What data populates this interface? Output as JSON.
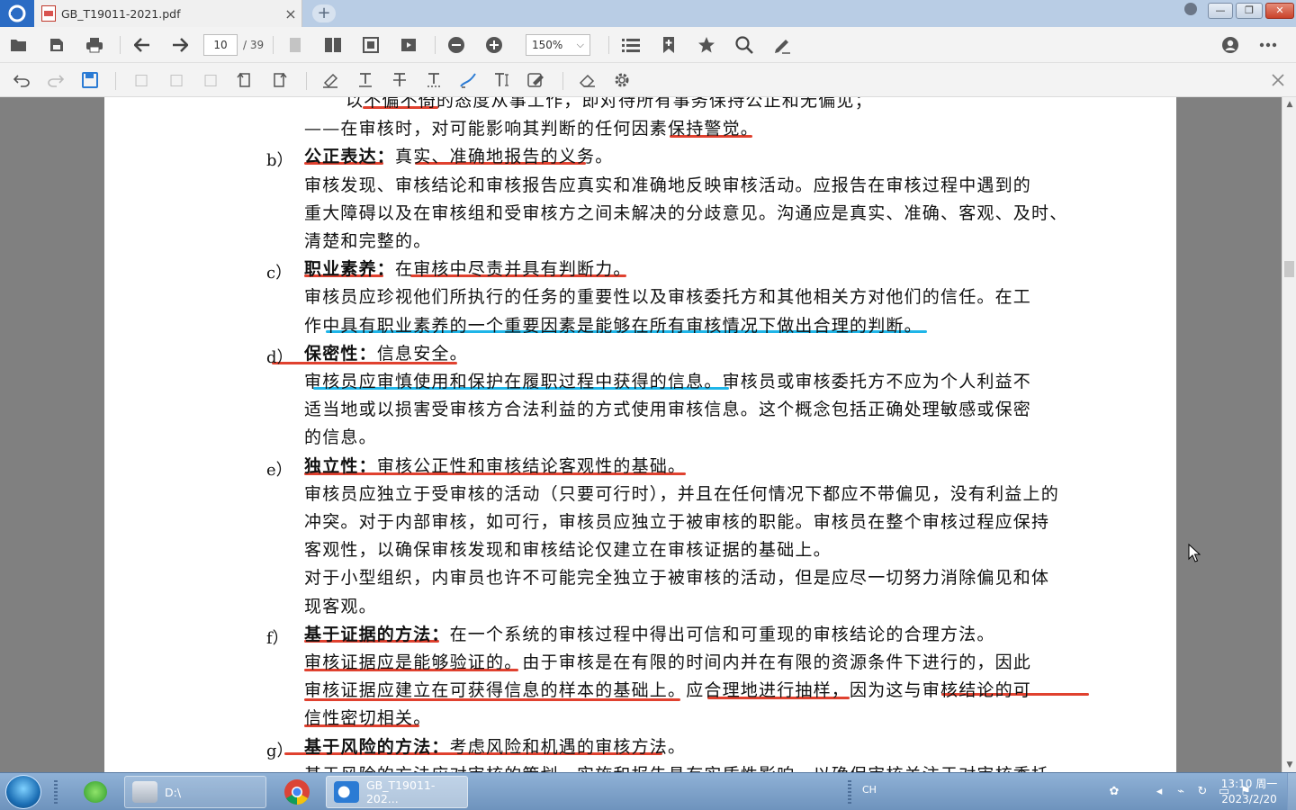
{
  "window": {
    "tab_title": "GB_T19011-2021.pdf",
    "tab_close": "×",
    "new_tab": "+",
    "min": "—",
    "max": "❐",
    "close": "✕"
  },
  "toolbar": {
    "page_current": "10",
    "page_total": "/ 39",
    "zoom": "150%"
  },
  "document": {
    "lines": [
      {
        "label": "",
        "text": "以不偏不倚的态度从事工作，即对待所有事务保持公正和无偏见；"
      },
      {
        "label": "",
        "text": "——在审核时，对可能影响其判断的任何因素保持警觉。"
      },
      {
        "label": "b）",
        "bold": "公正表达：",
        "text": "真实、准确地报告的义务。"
      },
      {
        "label": "",
        "text": "审核发现、审核结论和审核报告应真实和准确地反映审核活动。应报告在审核过程中遇到的"
      },
      {
        "label": "",
        "text": "重大障碍以及在审核组和受审核方之间未解决的分歧意见。沟通应是真实、准确、客观、及时、"
      },
      {
        "label": "",
        "text": "清楚和完整的。"
      },
      {
        "label": "c）",
        "bold": "职业素养：",
        "text": "在审核中尽责并具有判断力。"
      },
      {
        "label": "",
        "text": "审核员应珍视他们所执行的任务的重要性以及审核委托方和其他相关方对他们的信任。在工"
      },
      {
        "label": "",
        "text": "作中具有职业素养的一个重要因素是能够在所有审核情况下做出合理的判断。"
      },
      {
        "label": "d）",
        "bold": "保密性：",
        "text": "信息安全。"
      },
      {
        "label": "",
        "text": "审核员应审慎使用和保护在履职过程中获得的信息。审核员或审核委托方不应为个人利益不"
      },
      {
        "label": "",
        "text": "适当地或以损害受审核方合法利益的方式使用审核信息。这个概念包括正确处理敏感或保密"
      },
      {
        "label": "",
        "text": "的信息。"
      },
      {
        "label": "e）",
        "bold": "独立性：",
        "text": "审核公正性和审核结论客观性的基础。"
      },
      {
        "label": "",
        "text": "审核员应独立于受审核的活动（只要可行时），并且在任何情况下都应不带偏见，没有利益上的"
      },
      {
        "label": "",
        "text": "冲突。对于内部审核，如可行，审核员应独立于被审核的职能。审核员在整个审核过程应保持"
      },
      {
        "label": "",
        "text": "客观性，以确保审核发现和审核结论仅建立在审核证据的基础上。"
      },
      {
        "label": "",
        "text": "对于小型组织，内审员也许不可能完全独立于被审核的活动，但是应尽一切努力消除偏见和体"
      },
      {
        "label": "",
        "text": "现客观。"
      },
      {
        "label": "f）",
        "bold": "基于证据的方法：",
        "text": "在一个系统的审核过程中得出可信和可重现的审核结论的合理方法。"
      },
      {
        "label": "",
        "text": "审核证据应是能够验证的。由于审核是在有限的时间内并在有限的资源条件下进行的，因此"
      },
      {
        "label": "",
        "text": "审核证据应建立在可获得信息的样本的基础上。应合理地进行抽样，因为这与审核结论的可"
      },
      {
        "label": "",
        "text": "信性密切相关。"
      },
      {
        "label": "g）",
        "bold": "基于风险的方法：",
        "text": "考虑风险和机遇的审核方法。"
      },
      {
        "label": "",
        "text": "基于风险的方法应对审核的策划、实施和报告具有实质性影响，以确保审核关注于对审核委托"
      }
    ]
  },
  "taskbar": {
    "explorer_label": "D:\\",
    "pdf_label": "GB_T19011-202...",
    "lang": "CH",
    "time": "13:10 周一",
    "date": "2023/2/20"
  }
}
